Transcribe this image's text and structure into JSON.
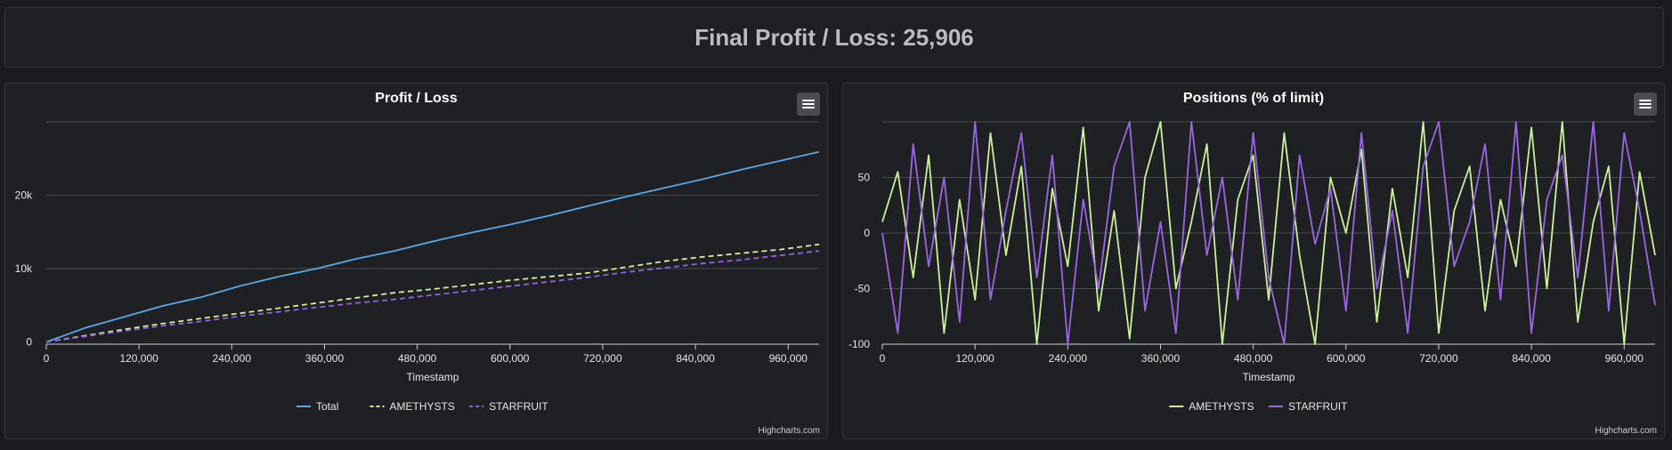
{
  "header": {
    "title": "Final Profit / Loss: 25,906"
  },
  "credits": "Highcharts.com",
  "chart_data": [
    {
      "type": "line",
      "title": "Profit / Loss",
      "xlabel": "Timestamp",
      "ylabel": "",
      "xlim": [
        0,
        1000000
      ],
      "ylim": [
        -300,
        30000
      ],
      "grid": true,
      "legend_position": "bottom-center",
      "x_ticks": [
        "0",
        "120,000",
        "240,000",
        "360,000",
        "480,000",
        "600,000",
        "720,000",
        "840,000",
        "960,000"
      ],
      "y_ticks": [
        "0",
        "10k",
        "20k"
      ],
      "x": [
        0,
        50000,
        100000,
        150000,
        200000,
        250000,
        300000,
        350000,
        400000,
        450000,
        500000,
        550000,
        600000,
        650000,
        700000,
        750000,
        800000,
        850000,
        900000,
        950000,
        1000000
      ],
      "series": [
        {
          "name": "Total",
          "color": "#5aa8e8",
          "dash": "solid",
          "values": [
            0,
            1900,
            3400,
            4900,
            6100,
            7600,
            8900,
            10000,
            11300,
            12400,
            13700,
            14900,
            16000,
            17200,
            18500,
            19800,
            21000,
            22200,
            23500,
            24700,
            25906
          ]
        },
        {
          "name": "AMETHYSTS",
          "color": "#d8ee9c",
          "dash": "dashed",
          "values": [
            0,
            850,
            1700,
            2500,
            3200,
            3900,
            4600,
            5300,
            6000,
            6700,
            7200,
            7800,
            8400,
            8900,
            9400,
            10200,
            11000,
            11600,
            12100,
            12600,
            13300
          ]
        },
        {
          "name": "STARFRUIT",
          "color": "#9462e0",
          "dash": "dashed",
          "values": [
            0,
            750,
            1500,
            2200,
            2800,
            3500,
            4100,
            4700,
            5300,
            5800,
            6400,
            7000,
            7600,
            8200,
            8800,
            9500,
            10100,
            10700,
            11200,
            11800,
            12400
          ]
        }
      ]
    },
    {
      "type": "line",
      "title": "Positions (% of limit)",
      "xlabel": "Timestamp",
      "ylabel": "",
      "xlim": [
        0,
        1000000
      ],
      "ylim": [
        -100,
        100
      ],
      "grid": true,
      "legend_position": "bottom-center",
      "x_ticks": [
        "0",
        "120,000",
        "240,000",
        "360,000",
        "480,000",
        "600,000",
        "720,000",
        "840,000",
        "960,000"
      ],
      "y_ticks": [
        "-100",
        "-50",
        "0",
        "50"
      ],
      "x": [
        0,
        20000,
        40000,
        60000,
        80000,
        100000,
        120000,
        140000,
        160000,
        180000,
        200000,
        220000,
        240000,
        260000,
        280000,
        300000,
        320000,
        340000,
        360000,
        380000,
        400000,
        420000,
        440000,
        460000,
        480000,
        500000,
        520000,
        540000,
        560000,
        580000,
        600000,
        620000,
        640000,
        660000,
        680000,
        700000,
        720000,
        740000,
        760000,
        780000,
        800000,
        820000,
        840000,
        860000,
        880000,
        900000,
        920000,
        940000,
        960000,
        980000,
        1000000
      ],
      "series": [
        {
          "name": "AMETHYSTS",
          "color": "#cbef9a",
          "dash": "solid",
          "values": [
            10,
            55,
            -40,
            70,
            -90,
            30,
            -60,
            90,
            -20,
            60,
            -100,
            40,
            -30,
            95,
            -70,
            20,
            -95,
            50,
            100,
            -50,
            10,
            80,
            -100,
            30,
            70,
            -60,
            90,
            -20,
            -100,
            50,
            0,
            75,
            -80,
            40,
            -40,
            100,
            -90,
            20,
            60,
            -70,
            30,
            -30,
            95,
            -50,
            100,
            -80,
            10,
            60,
            -100,
            55,
            -20
          ]
        },
        {
          "name": "STARFRUIT",
          "color": "#9a66e2",
          "dash": "solid",
          "values": [
            0,
            -90,
            80,
            -30,
            50,
            -80,
            100,
            -60,
            20,
            90,
            -40,
            70,
            -100,
            30,
            -50,
            60,
            100,
            -70,
            10,
            -90,
            100,
            -20,
            50,
            -60,
            90,
            -40,
            -100,
            70,
            -10,
            40,
            -70,
            90,
            -50,
            20,
            -90,
            60,
            100,
            -30,
            10,
            80,
            -60,
            100,
            -90,
            30,
            70,
            -40,
            100,
            -70,
            90,
            20,
            -65
          ]
        }
      ]
    }
  ]
}
